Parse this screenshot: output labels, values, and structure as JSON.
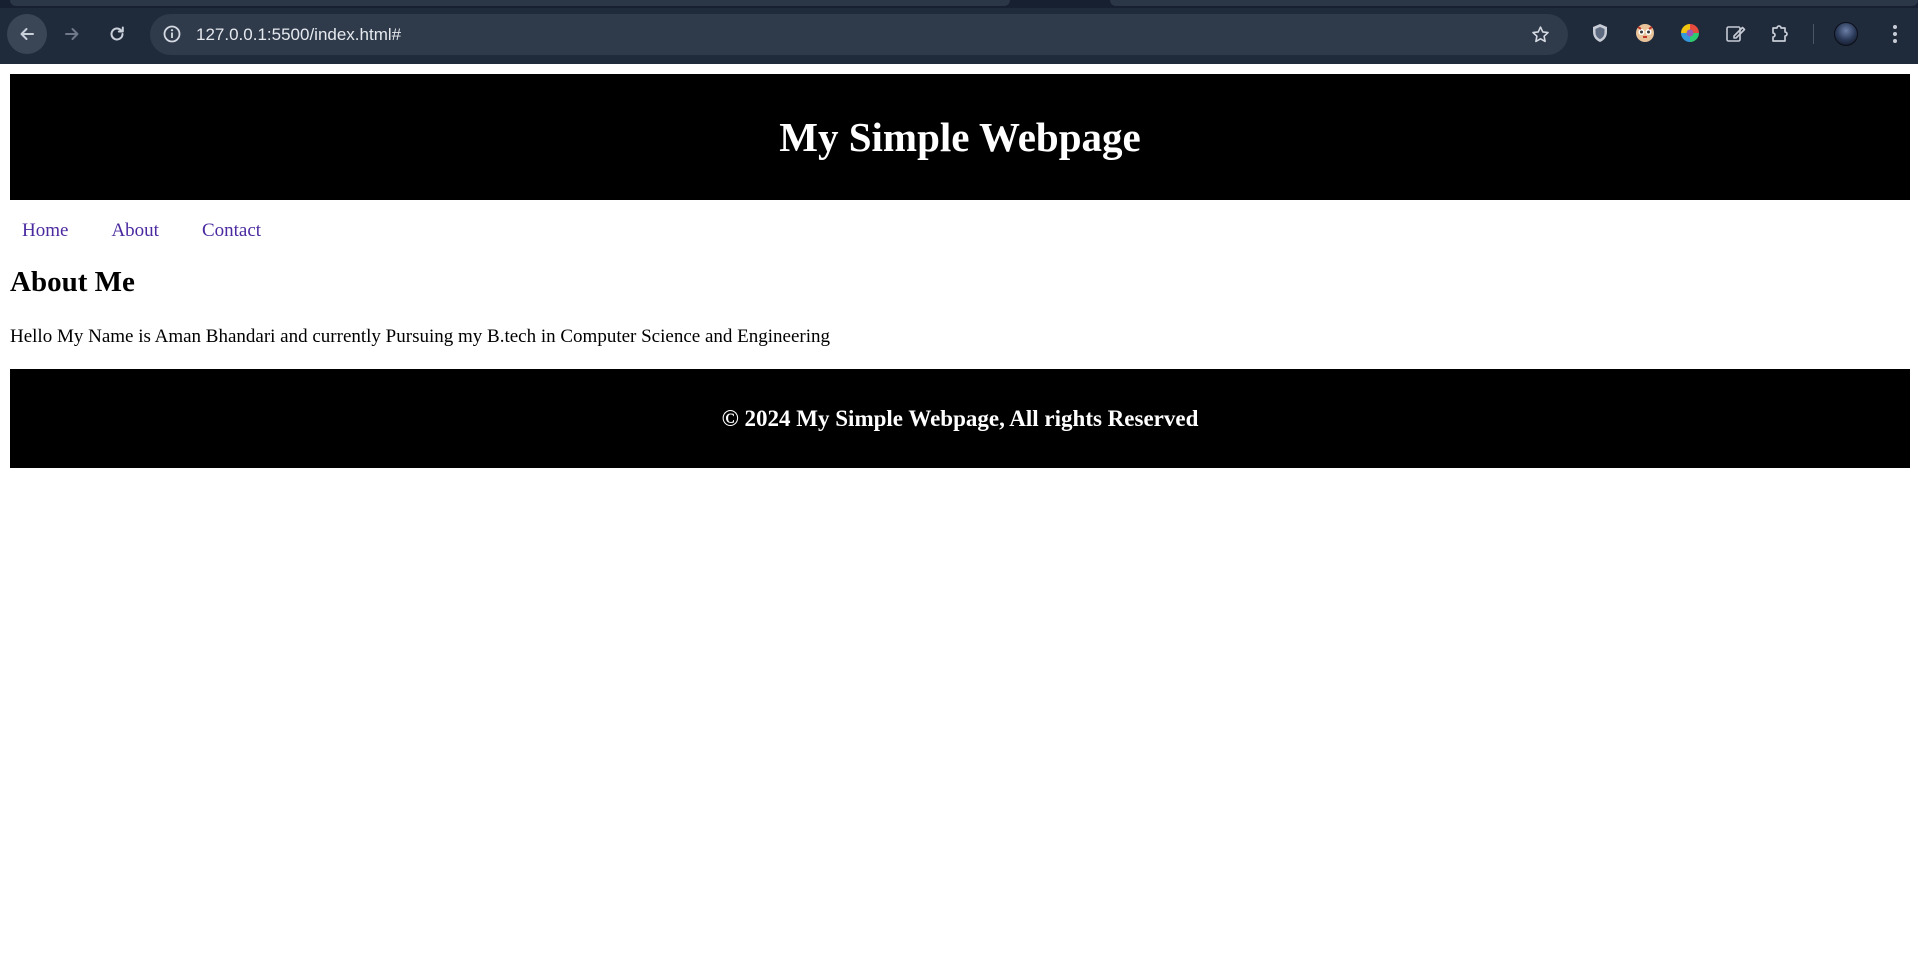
{
  "browser": {
    "url": "127.0.0.1:5500/index.html#",
    "icons": {
      "back": "arrow-left-icon",
      "forward": "arrow-right-icon",
      "reload": "reload-icon",
      "site_info": "info-icon",
      "bookmark": "star-icon",
      "extensions": [
        "shield-extension-icon",
        "owl-extension-icon",
        "color-wheel-extension-icon",
        "edit-note-extension-icon",
        "puzzle-extensions-icon"
      ],
      "menu": "kebab-menu-icon"
    },
    "colors": {
      "toolbar_bg": "#1f2a3b",
      "omnibox_bg": "#2f3a4b"
    }
  },
  "site": {
    "header_title": "My Simple Webpage",
    "nav": [
      {
        "label": "Home"
      },
      {
        "label": "About"
      },
      {
        "label": "Contact"
      }
    ],
    "about": {
      "heading": "About Me",
      "text": "Hello My Name is Aman Bhandari and currently Pursuing my B.tech in Computer Science and Engineering"
    },
    "footer_text": "© 2024 My Simple Webpage, All rights Reserved",
    "colors": {
      "header_bg": "#000000",
      "footer_bg": "#000000",
      "link": "#4b2aa0"
    }
  }
}
